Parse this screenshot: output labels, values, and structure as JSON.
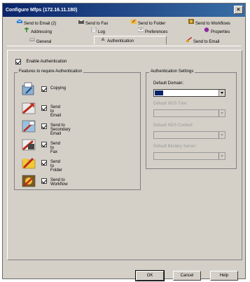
{
  "window": {
    "title": "Configure Mfps (172.16.11.180)"
  },
  "tabs": {
    "row1": [
      {
        "label": "Send to Email (2)",
        "icon": "email-tab-icon"
      },
      {
        "label": "Send to Fax",
        "icon": "fax-tab-icon"
      },
      {
        "label": "Send to Folder",
        "icon": "folder-tab-icon"
      },
      {
        "label": "Send to Workflows",
        "icon": "workflow-tab-icon"
      }
    ],
    "row2": [
      {
        "label": "Addressing",
        "icon": "addressing-tab-icon"
      },
      {
        "label": "Log",
        "icon": "log-tab-icon"
      },
      {
        "label": "Preferences",
        "icon": "preferences-tab-icon"
      },
      {
        "label": "Properties",
        "icon": "properties-tab-icon"
      }
    ],
    "row3": [
      {
        "label": "General",
        "icon": "general-tab-icon"
      },
      {
        "label": "Authentication",
        "icon": "authentication-tab-icon",
        "active": true
      },
      {
        "label": "Send to Email",
        "icon": "send-email-tab-icon"
      }
    ]
  },
  "enable_auth": {
    "label": "Enable Authentication",
    "checked": true
  },
  "features": {
    "title": "Features to require Authentication",
    "items": [
      {
        "label": "Copying",
        "checked": true
      },
      {
        "label": "Send to Email",
        "checked": true
      },
      {
        "label": "Send to Secondary Email",
        "checked": true
      },
      {
        "label": "Send to Fax",
        "checked": true
      },
      {
        "label": "Send to Folder",
        "checked": true
      },
      {
        "label": "Send to Workflow",
        "checked": true
      }
    ]
  },
  "auth_settings": {
    "title": "Authentication Settings",
    "default_domain_label": "Default Domain:",
    "default_domain_value": "",
    "nds_tree_label": "Default NDS Tree:",
    "nds_context_label": "Default NDS Context:",
    "bindery_server_label": "Default Bindery Server:"
  },
  "buttons": {
    "ok": "OK",
    "cancel": "Cancel",
    "help": "Help"
  }
}
